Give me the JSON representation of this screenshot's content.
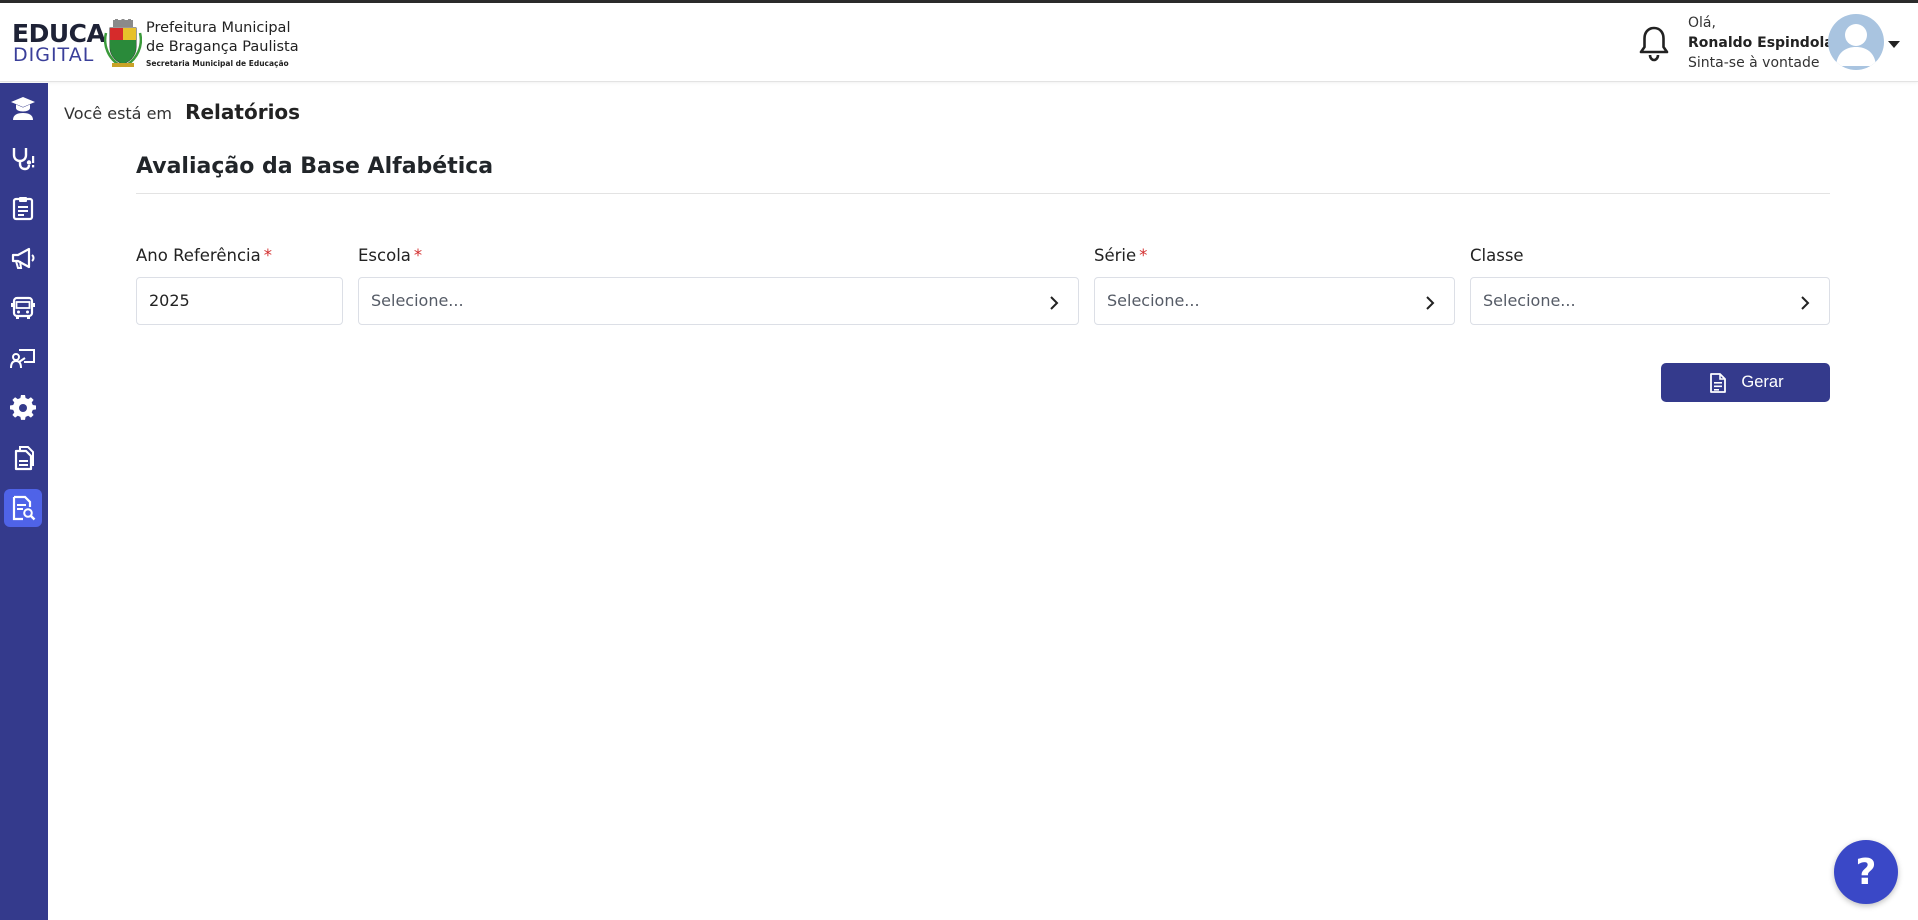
{
  "header": {
    "logo_educa": "EDUCA",
    "logo_digital": "DIGITAL",
    "logo_pref_line1": "Prefeitura Municipal",
    "logo_pref_line2": "de Bragança Paulista",
    "logo_secretaria": "Secretaria Municipal de Educação",
    "greeting": "Olá,",
    "user_name": "Ronaldo Espindola",
    "tagline": "Sinta-se à vontade"
  },
  "sidebar": {
    "items": [
      {
        "icon": "graduation-user-icon",
        "active": false
      },
      {
        "icon": "stethoscope-icon",
        "active": false
      },
      {
        "icon": "clipboard-icon",
        "active": false
      },
      {
        "icon": "megaphone-icon",
        "active": false
      },
      {
        "icon": "bus-icon",
        "active": false
      },
      {
        "icon": "teacher-board-icon",
        "active": false
      },
      {
        "icon": "gear-icon",
        "active": false
      },
      {
        "icon": "documents-icon",
        "active": false
      },
      {
        "icon": "report-search-icon",
        "active": true
      }
    ]
  },
  "breadcrumb": {
    "prefix": "Você está em",
    "current": "Relatórios"
  },
  "form": {
    "title": "Avaliação da Base Alfabética",
    "ano": {
      "label": "Ano Referência",
      "required": "*",
      "value": "2025"
    },
    "escola": {
      "label": "Escola",
      "required": "*",
      "placeholder": "Selecione..."
    },
    "serie": {
      "label": "Série",
      "required": "*",
      "placeholder": "Selecione..."
    },
    "classe": {
      "label": "Classe",
      "placeholder": "Selecione..."
    },
    "submit_label": "Gerar"
  },
  "help": {
    "label": "?"
  },
  "colors": {
    "sidebar": "#343a8c",
    "active": "#4f63e8",
    "primary_button": "#343a8c",
    "required": "#d32f2f",
    "help_button": "#3a48c7"
  }
}
